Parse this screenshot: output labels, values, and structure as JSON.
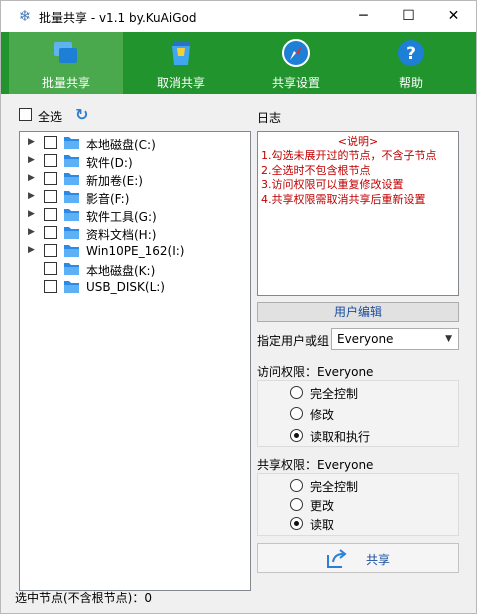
{
  "window": {
    "title": "批量共享 - v1.1 by.KuAiGod",
    "app_icon": "snowflake-icon",
    "minimize_glyph": "─",
    "maximize_glyph": "☐",
    "close_glyph": "✕"
  },
  "toolbar": {
    "accent_color": "#22942e",
    "items": [
      {
        "label": "批量共享",
        "icon": "windows-blue-icon"
      },
      {
        "label": "取消共享",
        "icon": "trash-bin-icon"
      },
      {
        "label": "共享设置",
        "icon": "compass-icon"
      },
      {
        "label": "帮助",
        "icon": "question-icon"
      }
    ]
  },
  "tree": {
    "select_all_label": "全选",
    "refresh_icon": "refresh-icon",
    "nodes": [
      {
        "label": "本地磁盘(C:)",
        "expandable": true
      },
      {
        "label": "软件(D:)",
        "expandable": true
      },
      {
        "label": "新加卷(E:)",
        "expandable": true
      },
      {
        "label": "影音(F:)",
        "expandable": true
      },
      {
        "label": "软件工具(G:)",
        "expandable": true
      },
      {
        "label": "资料文档(H:)",
        "expandable": true
      },
      {
        "label": "Win10PE_162(I:)",
        "expandable": true
      },
      {
        "label": "本地磁盘(K:)",
        "expandable": false
      },
      {
        "label": "USB_DISK(L:)",
        "expandable": false
      }
    ]
  },
  "log": {
    "title": "日志",
    "heading": "<说明>",
    "lines": [
      "1.勾选未展开过的节点，不含子节点",
      "2.全选时不包含根节点",
      "3.访问权限可以重复修改设置",
      "4.共享权限需取消共享后重新设置"
    ],
    "text_color": "#c00000"
  },
  "user": {
    "edit_button": "用户编辑",
    "specify_label": "指定用户或组",
    "selected": "Everyone"
  },
  "access": {
    "label": "访问权限：Everyone",
    "options": [
      "完全控制",
      "修改",
      "读取和执行"
    ],
    "selected_index": 2
  },
  "share_perm": {
    "label": "共享权限：Everyone",
    "options": [
      "完全控制",
      "更改",
      "读取"
    ],
    "selected_index": 2
  },
  "share_button": {
    "label": "共享",
    "icon": "share-icon"
  },
  "status": {
    "text": "选中节点(不含根节点)：0"
  }
}
